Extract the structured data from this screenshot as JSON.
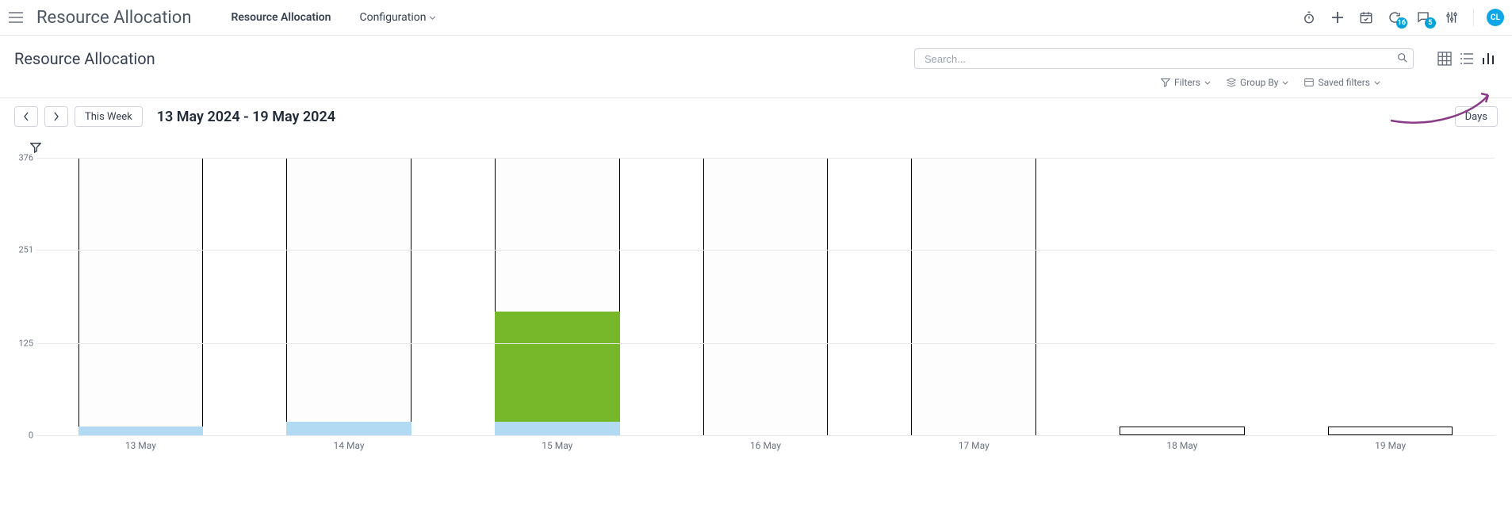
{
  "header": {
    "app_title": "Resource Allocation",
    "tabs": [
      {
        "label": "Resource Allocation"
      },
      {
        "label": "Configuration"
      }
    ],
    "badges": {
      "refresh": "16",
      "chat": "5"
    },
    "avatar_initials": "CL"
  },
  "subheader": {
    "page_title": "Resource Allocation",
    "search_placeholder": "Search...",
    "controls": {
      "filters_label": "Filters",
      "group_by_label": "Group By",
      "saved_filters_label": "Saved filters"
    }
  },
  "toolbar": {
    "this_week_label": "This Week",
    "range_label": "13 May 2024 - 19 May 2024",
    "days_label": "Days"
  },
  "chart_data": {
    "type": "bar",
    "categories": [
      "13 May",
      "14 May",
      "15 May",
      "16 May",
      "17 May",
      "18 May",
      "19 May"
    ],
    "series": [
      {
        "name": "planned_outline",
        "values": [
          376,
          376,
          376,
          376,
          376,
          12,
          12
        ]
      },
      {
        "name": "blue",
        "values": [
          12,
          18,
          18,
          0,
          0,
          0,
          0
        ]
      },
      {
        "name": "green",
        "values": [
          0,
          0,
          150,
          0,
          0,
          0,
          0
        ]
      }
    ],
    "ylabel": "",
    "xlabel": "",
    "ylim": [
      0,
      376
    ],
    "y_ticks": [
      0,
      125,
      251,
      376
    ]
  },
  "colors": {
    "accent": "#8a3b86",
    "bar_green": "#76b82a",
    "bar_blue": "#b3daf3",
    "bar_outline": "#000000"
  }
}
